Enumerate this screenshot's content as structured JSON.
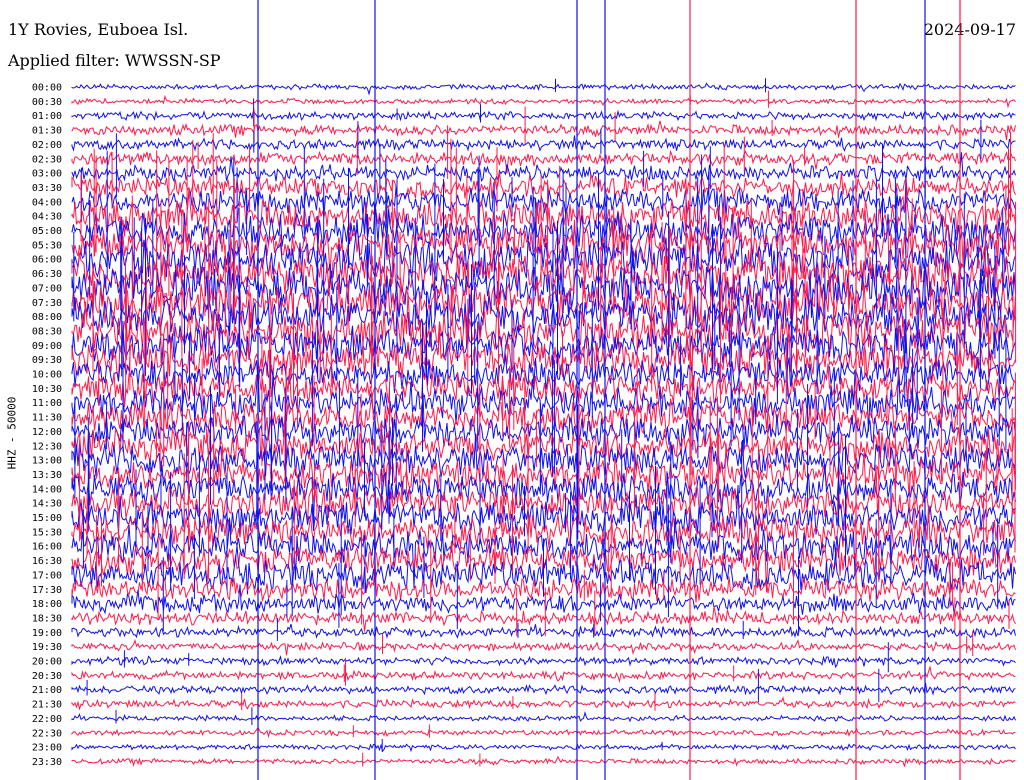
{
  "header": {
    "station": "1Y Rovies, Euboea Isl.",
    "date": "2024-09-17",
    "filter": "Applied filter: WWSSN-SP"
  },
  "chart_data": {
    "type": "line",
    "ylabel": "HHZ - 50000",
    "colors": [
      "#1010ee",
      "#ff1a4a"
    ],
    "rows": [
      {
        "label": "00:00",
        "amp": 2
      },
      {
        "label": "00:30",
        "amp": 2
      },
      {
        "label": "01:00",
        "amp": 3
      },
      {
        "label": "01:30",
        "amp": 4
      },
      {
        "label": "02:00",
        "amp": 4
      },
      {
        "label": "02:30",
        "amp": 5
      },
      {
        "label": "03:00",
        "amp": 6
      },
      {
        "label": "03:30",
        "amp": 8
      },
      {
        "label": "04:00",
        "amp": 10
      },
      {
        "label": "04:30",
        "amp": 12
      },
      {
        "label": "05:00",
        "amp": 13
      },
      {
        "label": "05:30",
        "amp": 14
      },
      {
        "label": "06:00",
        "amp": 15
      },
      {
        "label": "06:30",
        "amp": 16
      },
      {
        "label": "07:00",
        "amp": 16
      },
      {
        "label": "07:30",
        "amp": 16
      },
      {
        "label": "08:00",
        "amp": 16
      },
      {
        "label": "08:30",
        "amp": 15
      },
      {
        "label": "09:00",
        "amp": 14
      },
      {
        "label": "09:30",
        "amp": 13
      },
      {
        "label": "10:00",
        "amp": 12
      },
      {
        "label": "10:30",
        "amp": 12
      },
      {
        "label": "11:00",
        "amp": 12
      },
      {
        "label": "11:30",
        "amp": 12
      },
      {
        "label": "12:00",
        "amp": 12
      },
      {
        "label": "12:30",
        "amp": 12
      },
      {
        "label": "13:00",
        "amp": 12
      },
      {
        "label": "13:30",
        "amp": 12
      },
      {
        "label": "14:00",
        "amp": 12
      },
      {
        "label": "14:30",
        "amp": 12
      },
      {
        "label": "15:00",
        "amp": 12
      },
      {
        "label": "15:30",
        "amp": 12
      },
      {
        "label": "16:00",
        "amp": 12
      },
      {
        "label": "16:30",
        "amp": 11
      },
      {
        "label": "17:00",
        "amp": 11
      },
      {
        "label": "17:30",
        "amp": 9
      },
      {
        "label": "18:00",
        "amp": 7
      },
      {
        "label": "18:30",
        "amp": 5
      },
      {
        "label": "19:00",
        "amp": 4
      },
      {
        "label": "19:30",
        "amp": 3
      },
      {
        "label": "20:00",
        "amp": 3
      },
      {
        "label": "20:30",
        "amp": 3
      },
      {
        "label": "21:00",
        "amp": 3
      },
      {
        "label": "21:30",
        "amp": 3
      },
      {
        "label": "22:00",
        "amp": 2
      },
      {
        "label": "22:30",
        "amp": 2
      },
      {
        "label": "23:00",
        "amp": 2
      },
      {
        "label": "23:30",
        "amp": 2
      }
    ]
  }
}
